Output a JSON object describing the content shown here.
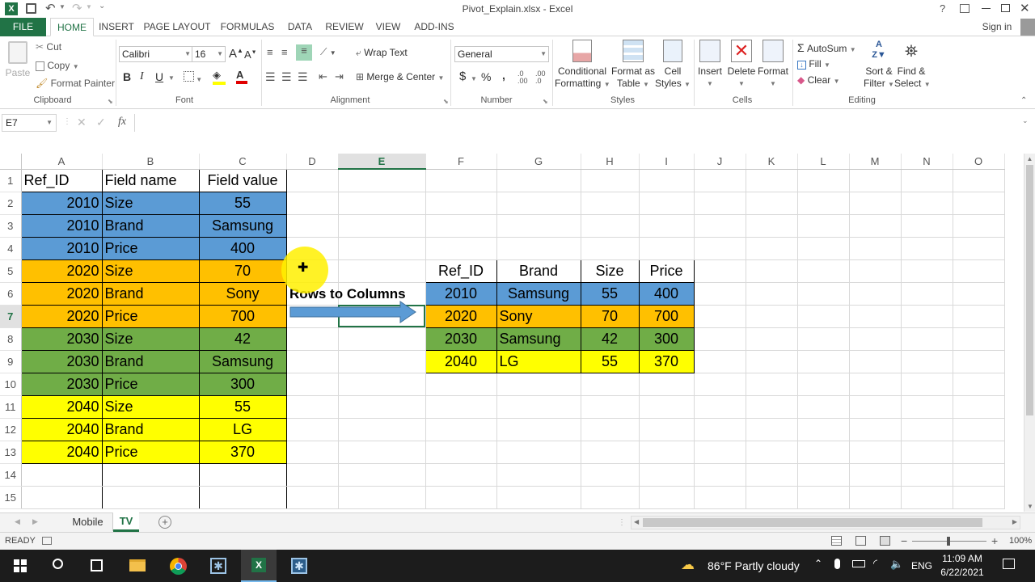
{
  "window": {
    "title": "Pivot_Explain.xlsx - Excel",
    "help": "?",
    "sign_in": "Sign in"
  },
  "ribbon_tabs": [
    "FILE",
    "HOME",
    "INSERT",
    "PAGE LAYOUT",
    "FORMULAS",
    "DATA",
    "REVIEW",
    "VIEW",
    "ADD-INS"
  ],
  "clipboard": {
    "paste": "Paste",
    "cut": "Cut",
    "copy": "Copy",
    "format_painter": "Format Painter",
    "label": "Clipboard"
  },
  "font": {
    "name": "Calibri",
    "size": "16",
    "bold": "B",
    "italic": "I",
    "underline": "U",
    "label": "Font"
  },
  "alignment": {
    "wrap_text": "Wrap Text",
    "merge_center": "Merge & Center",
    "label": "Alignment"
  },
  "number": {
    "format": "General",
    "currency": "$",
    "percent": "%",
    "comma": ",",
    "label": "Number"
  },
  "styles": {
    "conditional": "Conditional",
    "conditional2": "Formatting",
    "format_as": "Format as",
    "format_as2": "Table",
    "cell": "Cell",
    "cell2": "Styles",
    "label": "Styles"
  },
  "cells": {
    "insert": "Insert",
    "delete": "Delete",
    "format": "Format",
    "label": "Cells"
  },
  "editing": {
    "autosum": "AutoSum",
    "fill": "Fill",
    "clear": "Clear",
    "sort": "Sort &",
    "sort2": "Filter",
    "find": "Find &",
    "find2": "Select",
    "label": "Editing"
  },
  "formula_bar": {
    "name_box": "E7",
    "fx": "fx",
    "content": ""
  },
  "columns": [
    "A",
    "B",
    "C",
    "D",
    "E",
    "F",
    "G",
    "H",
    "I",
    "J",
    "K",
    "L",
    "M",
    "N",
    "O"
  ],
  "rows": [
    "1",
    "2",
    "3",
    "4",
    "5",
    "6",
    "7",
    "8",
    "9",
    "10",
    "11",
    "12",
    "13",
    "14",
    "15"
  ],
  "source_table": {
    "headers": [
      "Ref_ID",
      "Field name",
      "Field value"
    ],
    "rows": [
      [
        "2010",
        "Size",
        "55"
      ],
      [
        "2010",
        "Brand",
        "Samsung"
      ],
      [
        "2010",
        "Price",
        "400"
      ],
      [
        "2020",
        "Size",
        "70"
      ],
      [
        "2020",
        "Brand",
        "Sony"
      ],
      [
        "2020",
        "Price",
        "700"
      ],
      [
        "2030",
        "Size",
        "42"
      ],
      [
        "2030",
        "Brand",
        "Samsung"
      ],
      [
        "2030",
        "Price",
        "300"
      ],
      [
        "2040",
        "Size",
        "55"
      ],
      [
        "2040",
        "Brand",
        "LG"
      ],
      [
        "2040",
        "Price",
        "370"
      ]
    ]
  },
  "arrow_label": "Rows to Columns",
  "pivot_table": {
    "headers": [
      "Ref_ID",
      "Brand",
      "Size",
      "Price"
    ],
    "rows": [
      [
        "2010",
        "Samsung",
        "55",
        "400"
      ],
      [
        "2020",
        "Sony",
        "70",
        "700"
      ],
      [
        "2030",
        "Samsung",
        "42",
        "300"
      ],
      [
        "2040",
        "LG",
        "55",
        "370"
      ]
    ]
  },
  "group_colors": {
    "g2010": "#5b9bd5",
    "g2020": "#ffc000",
    "g2030": "#70ad47",
    "g2040": "#ffff00"
  },
  "sheets": [
    "Mobile",
    "TV"
  ],
  "active_sheet": "TV",
  "status": {
    "ready": "READY",
    "zoom": "100%"
  },
  "taskbar": {
    "weather": "86°F  Partly cloudy",
    "lang": "ENG",
    "time": "11:09 AM",
    "date": "6/22/2021"
  }
}
